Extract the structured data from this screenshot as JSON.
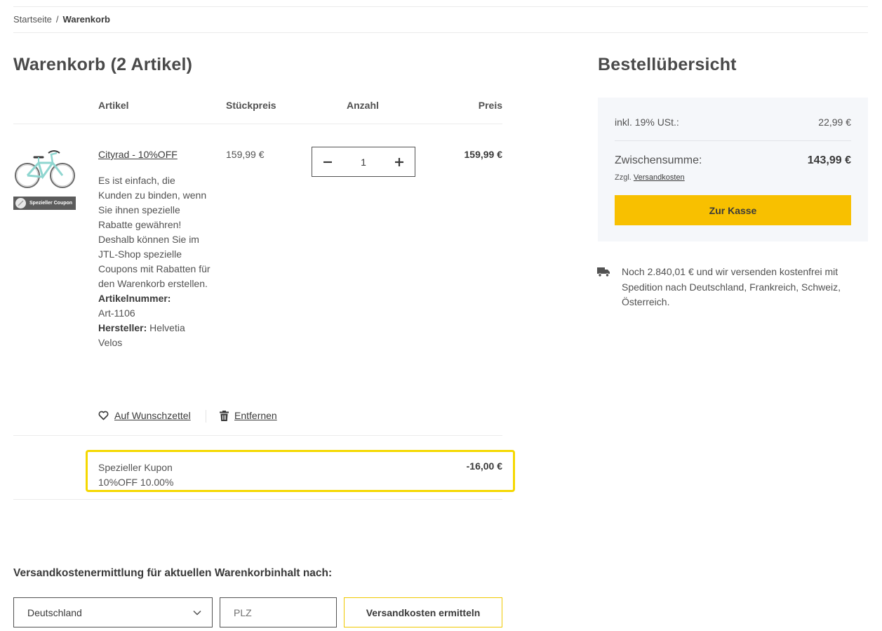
{
  "breadcrumb": {
    "home": "Startseite",
    "separator": "/",
    "current": "Warenkorb"
  },
  "cart": {
    "title": "Warenkorb (2 Artikel)",
    "columns": {
      "article": "Artikel",
      "unit_price": "Stückpreis",
      "quantity": "Anzahl",
      "price": "Preis"
    },
    "item": {
      "name": "Cityrad - 10%OFF",
      "coupon_tag": "Spezieller Coupon",
      "description": "Es ist einfach, die Kunden zu binden, wenn Sie ihnen spezielle Rabatte gewähren! Deshalb können Sie im JTL-Shop spezielle Coupons mit Rabatten für den Warenkorb erstellen.",
      "sku_label": "Artikelnummer:",
      "sku": "Art-1106",
      "manufacturer_label": "Hersteller:",
      "manufacturer": "Helvetia Velos",
      "unit_price": "159,99 €",
      "quantity": "1",
      "price": "159,99 €",
      "wishlist_label": "Auf Wunschzettel",
      "remove_label": "Entfernen"
    },
    "coupon": {
      "line1": "Spezieller Kupon",
      "line2": "10%OFF 10.00%",
      "amount": "-16,00 €"
    }
  },
  "shipping_calc": {
    "title": "Versandkostenermittlung für aktuellen Warenkorbinhalt nach:",
    "country": "Deutschland",
    "zip_placeholder": "PLZ",
    "button": "Versandkosten ermitteln"
  },
  "summary": {
    "title": "Bestellübersicht",
    "vat_label": "inkl. 19% USt.:",
    "vat_value": "22,99 €",
    "subtotal_label": "Zwischensumme:",
    "subtotal_value": "143,99 €",
    "shipping_prefix": "Zzgl.",
    "shipping_link": "Versandkosten",
    "checkout": "Zur Kasse",
    "free_shipping": "Noch 2.840,01 € und wir versenden kostenfrei mit Spedition nach Deutschland, Frankreich, Schweiz, Österreich."
  },
  "colors": {
    "accent": "#f8c000",
    "highlight": "#f5d800",
    "summary_bg": "#f5f7fa"
  }
}
